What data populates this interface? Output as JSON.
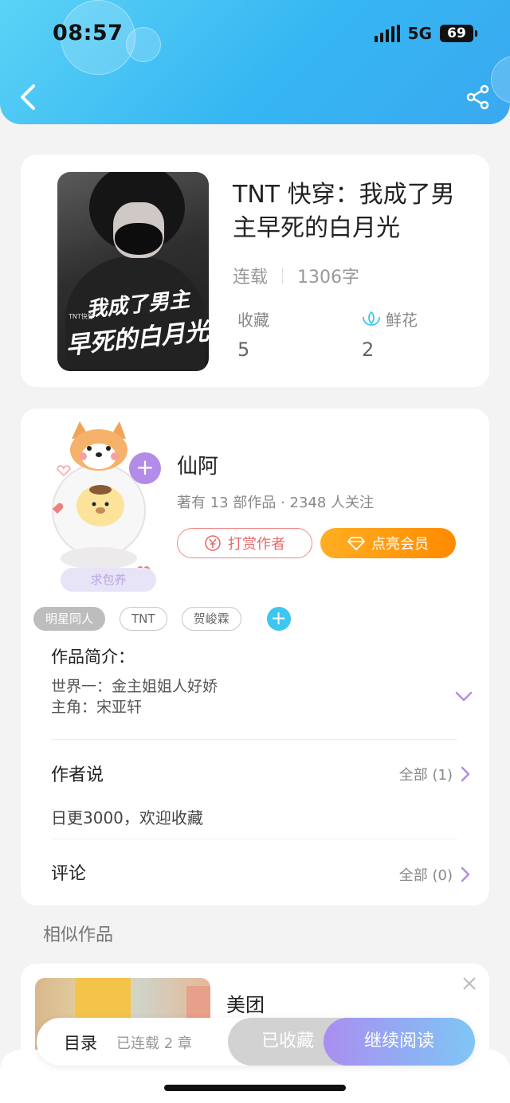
{
  "status_bar": {
    "time": "08:57",
    "network": "5G",
    "battery": "69"
  },
  "header": {
    "back_icon": "chevron-left-icon",
    "share_icon": "share-icon",
    "accent_color": "#36b6f2"
  },
  "book": {
    "title": "TNT 快穿：我成了男主早死的白月光",
    "cover_subtitle": "TNT快穿",
    "cover_title_line1": "我成了男主",
    "cover_title_line2": "早死的白月光",
    "status": "连载",
    "word_count": "1306字",
    "favorites_label": "收藏",
    "favorites_value": "5",
    "flowers_label": "鲜花",
    "flowers_value": "2"
  },
  "author": {
    "name": "仙阿",
    "info": "著有 13 部作品 · 2348 人关注",
    "badge": "求包养",
    "reward_label": "打赏作者",
    "vip_label": "点亮会员"
  },
  "tags": [
    "明星同人",
    "TNT",
    "贺峻霖"
  ],
  "intro": {
    "title": "作品简介：",
    "text": "世界一：金主姐姐人好娇\n主角：宋亚轩"
  },
  "author_says": {
    "title": "作者说",
    "link": "全部 (1)",
    "content": "日更3000，欢迎收藏"
  },
  "comments": {
    "title": "评论",
    "link": "全部 (0)"
  },
  "similar": {
    "label": "相似作品",
    "item_name": "美团"
  },
  "bottom_bar": {
    "toc": "目录",
    "toc_sub": "已连载 2 章",
    "collected": "已收藏",
    "continue": "继续阅读"
  }
}
